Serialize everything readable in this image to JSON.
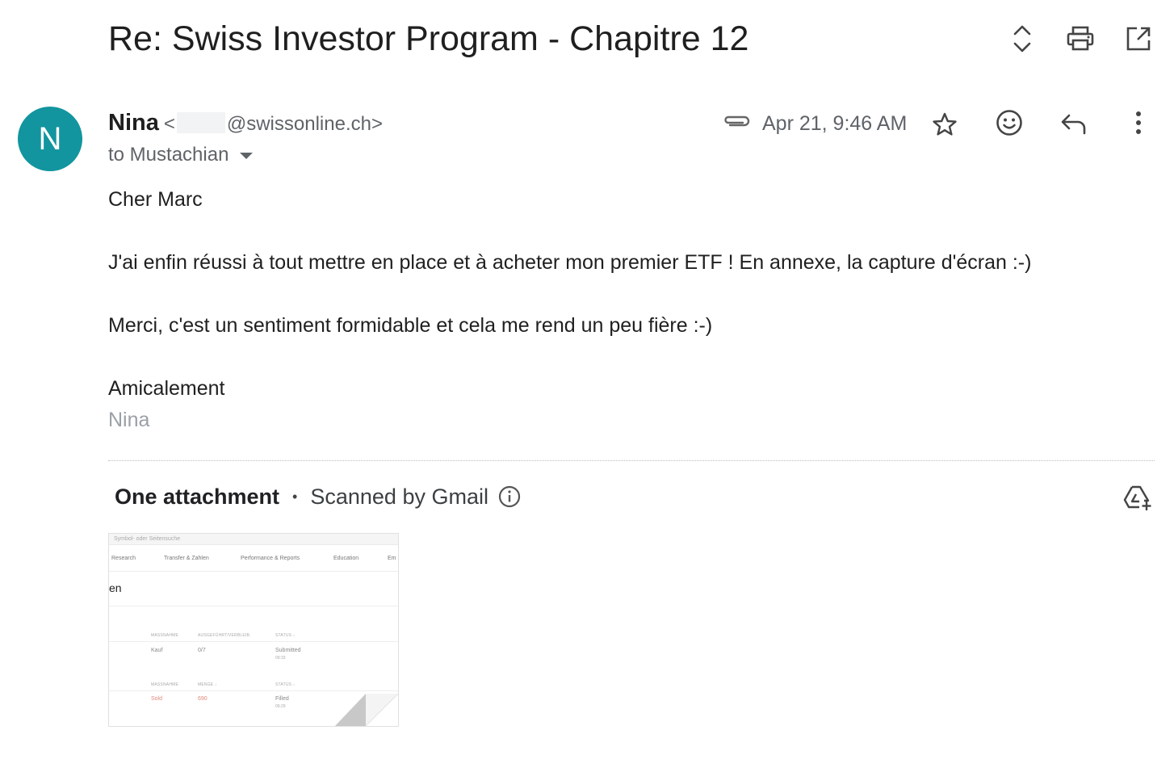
{
  "email": {
    "subject": "Re: Swiss Investor Program - Chapitre 12",
    "sender_initial": "N",
    "sender_name": "Nina",
    "sender_email_open": "<",
    "sender_email_domain": "@swissonline.ch>",
    "recipient_line": "to Mustachian",
    "date": "Apr 21, 9:46 AM",
    "body": {
      "greeting": "Cher Marc",
      "paragraph1": "J'ai enfin réussi à tout mettre en place et à acheter mon premier ETF ! En annexe, la capture d'écran :-)",
      "paragraph2": "Merci, c'est un sentiment formidable et cela me rend un peu fière :-)",
      "closing": "Amicalement",
      "signature": "Nina"
    }
  },
  "toolbar": {
    "expand_icon": "unfold-icon",
    "print_icon": "print-icon",
    "open_new_window_icon": "open-in-new-icon"
  },
  "actions": {
    "attachment_icon": "paperclip-icon",
    "star_icon": "star-icon",
    "emoji_icon": "emoji-icon",
    "reply_icon": "reply-icon",
    "more_icon": "more-vert-icon"
  },
  "attachments": {
    "count_label": "One attachment",
    "separator": "•",
    "scan_label": "Scanned by Gmail",
    "info_icon": "info-icon",
    "drive_icon": "add-to-drive-icon",
    "thumbnail": {
      "search_placeholder": "Symbol- oder Seitensuche",
      "nav": [
        "Research",
        "Transfer & Zahlen",
        "Performance & Reports",
        "Education",
        "Em"
      ],
      "heading_fragment": "en",
      "table1": {
        "headers": [
          "MASSNAHME",
          "AUSGEFÜHRT/VERBLEIB.",
          "STATUS ↓"
        ],
        "row": {
          "action": "Kauf",
          "qty": "0/7",
          "status": "Submitted",
          "time": "09:33"
        }
      },
      "table2": {
        "headers": [
          "MASSNAHME",
          "MENGE ↓",
          "STATUS ↓"
        ],
        "row": {
          "action": "Sold",
          "qty": "690",
          "status": "Filled",
          "time": "09:29"
        }
      }
    }
  },
  "colors": {
    "avatar_bg": "#12959e",
    "text_primary": "#1f1f1f",
    "text_secondary": "#5f6368",
    "signature": "#9aa0a6"
  }
}
